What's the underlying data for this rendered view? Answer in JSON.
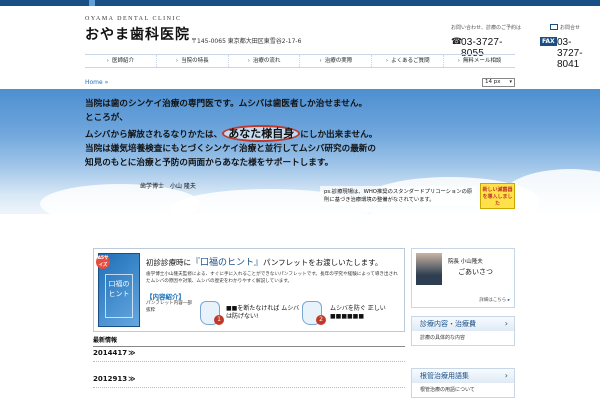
{
  "header": {
    "clinic_name_en": "OYAMA DENTAL CLINIC",
    "clinic_name_jp": "おやま歯科医院",
    "address": "〒145-0065 東京都大田区東雪谷2-17-6",
    "contact_label": "お問い合わせ、診療のご予約は",
    "tel_icon": "☎",
    "tel": "03-3727-8055",
    "fax_label": "お問合せ",
    "fax_icon": "FAX",
    "fax": "03-3727-8041"
  },
  "nav": {
    "items": [
      {
        "label": "医師紹介"
      },
      {
        "label": "当院の特長"
      },
      {
        "label": "治療の流れ"
      },
      {
        "label": "治療の実際"
      },
      {
        "label": "よくあるご質問"
      },
      {
        "label": "無料メール相談"
      }
    ]
  },
  "breadcrumb": "Home »",
  "font_size_select": {
    "value": "14 px"
  },
  "hero": {
    "lines": [
      "当院は歯のシンケイ治療の専門医です。ムシバは歯医者しか治せません。",
      "ところが、",
      "ムシバから解放されるなりかたは、",
      "当院は嫌気培養検査にもとづくシンケイ治療と並行してムシバ研究の最新の",
      "知見のもとに治療と予防の両面からあなた様をサポートします。"
    ],
    "highlight": "あなた様自身",
    "line3_suffix": "にしか出来ません。",
    "signature": "歯学博士　小山 隆夫",
    "ps_text": "ps.診療現場は、WHO推奨のスタンダードプリコーションの原則に基づき治療環境の整備がなされています。",
    "badge": "新しい滅菌器を導入しました"
  },
  "pamphlet": {
    "a5": "A5サイズ",
    "book_title": "口福のヒント",
    "head_prefix": "初診診療時に",
    "head_kw": "『口福のヒント』",
    "head_suffix": "パンフレットをお渡しいたします。",
    "desc": "歯学博士小山隆夫監修による、すぐに手に入れることができないパンフレットです。長年の学究や経験によって導き出されたムシバの原因や対策、ムシバの歴史をわかりやすく解説しています。",
    "contents_label": "【内容紹介】",
    "contents_note": "パンフレット内容一部抜粋",
    "point1_num": "1",
    "point1_text": "■■を断たなければ ムシバは防げない!",
    "point2_num": "2",
    "point2_text": "ムシバを防ぐ 正しい■■■■■■"
  },
  "profile": {
    "title": "院長 小山隆夫",
    "greeting": "ごあいさつ",
    "more": "詳細はこちら"
  },
  "side_buttons": [
    {
      "title": "診療内容・治療費",
      "sub": "診療の具体的な内容"
    },
    {
      "title": "根管治療用語集",
      "sub": "根管治療の用語について"
    }
  ],
  "news": {
    "heading": "最新情報",
    "items": [
      {
        "date": "2014417"
      },
      {
        "date": "2012913"
      }
    ]
  },
  "colors": {
    "brand_blue": "#1a4f86",
    "accent_red": "#c0392b",
    "sky": "#6fa6dc"
  }
}
